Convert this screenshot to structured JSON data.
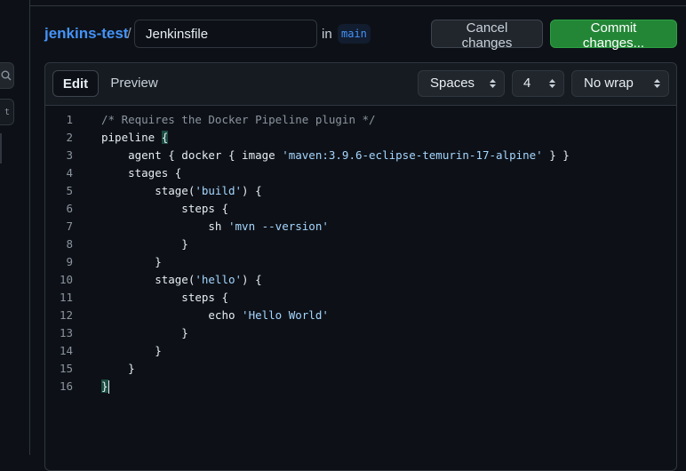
{
  "header": {
    "repo": "jenkins-test",
    "separator": "/",
    "filename": "Jenkinsfile",
    "in_label": "in",
    "branch": "main",
    "cancel_label": "Cancel changes",
    "commit_label": "Commit changes..."
  },
  "toolbar": {
    "edit_tab": "Edit",
    "preview_tab": "Preview",
    "indent_mode": "Spaces",
    "indent_size": "4",
    "wrap_mode": "No wrap"
  },
  "colors": {
    "accent": "#4493f8",
    "commit_green": "#238636",
    "string": "#a5d6ff",
    "comment": "#8b949e"
  },
  "code": {
    "lines": [
      "/* Requires the Docker Pipeline plugin */",
      "pipeline {",
      "    agent { docker { image 'maven:3.9.6-eclipse-temurin-17-alpine' } }",
      "    stages {",
      "        stage('build') {",
      "            steps {",
      "                sh 'mvn --version'",
      "            }",
      "        }",
      "        stage('hello') {",
      "            steps {",
      "                echo 'Hello World'",
      "            }",
      "        }",
      "    }",
      "}"
    ]
  }
}
